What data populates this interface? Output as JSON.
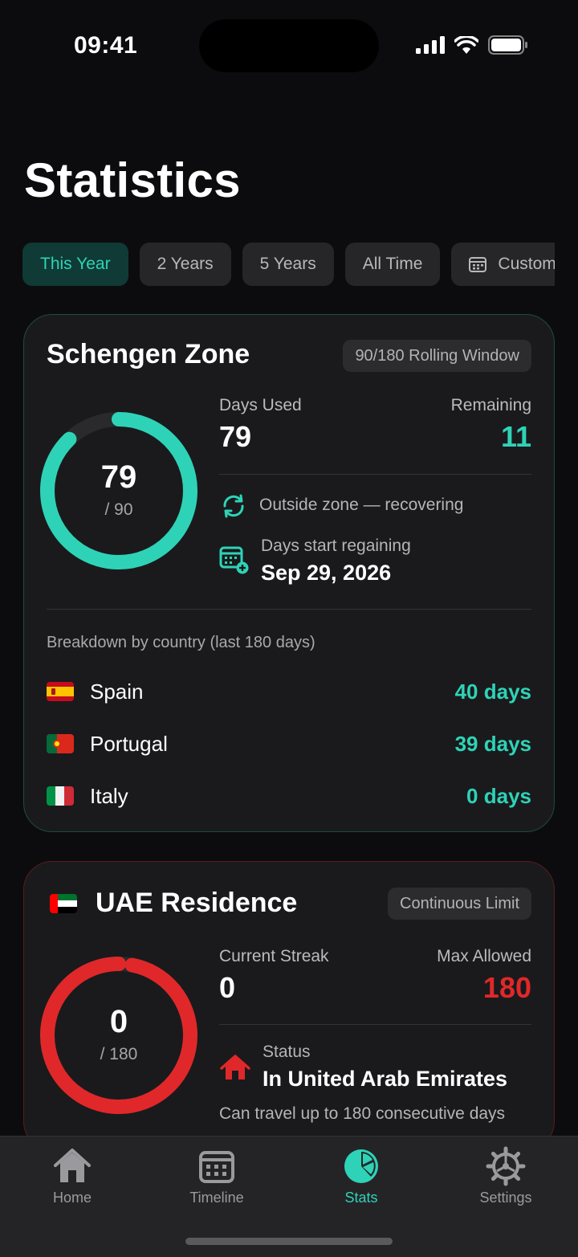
{
  "status_bar": {
    "time": "09:41"
  },
  "page": {
    "title": "Statistics"
  },
  "filters": [
    {
      "label": "This Year",
      "active": true
    },
    {
      "label": "2 Years",
      "active": false
    },
    {
      "label": "5 Years",
      "active": false
    },
    {
      "label": "All Time",
      "active": false
    },
    {
      "label": "Custom",
      "active": false,
      "icon": "calendar-icon"
    }
  ],
  "schengen": {
    "title": "Schengen Zone",
    "badge": "90/180 Rolling Window",
    "ring": {
      "value": "79",
      "sub": "/ 90",
      "progress": 0.878,
      "color": "#2ed3b7"
    },
    "days_used_label": "Days Used",
    "days_used": "79",
    "remaining_label": "Remaining",
    "remaining": "11",
    "status_text": "Outside zone — recovering",
    "regain_label": "Days start regaining",
    "regain_date": "Sep 29, 2026",
    "breakdown_label": "Breakdown by country (last 180 days)",
    "countries": [
      {
        "name": "Spain",
        "days": "40 days",
        "flag": "spain-flag"
      },
      {
        "name": "Portugal",
        "days": "39 days",
        "flag": "portugal-flag"
      },
      {
        "name": "Italy",
        "days": "0 days",
        "flag": "italy-flag"
      }
    ]
  },
  "uae": {
    "title": "UAE Residence",
    "badge": "Continuous Limit",
    "ring": {
      "value": "0",
      "sub": "/ 180",
      "progress": 1.0,
      "color": "#e0282a"
    },
    "streak_label": "Current Streak",
    "streak": "0",
    "max_label": "Max Allowed",
    "max": "180",
    "status_label": "Status",
    "status": "In United Arab Emirates",
    "note": "Can travel up to 180 consecutive days"
  },
  "tabs": [
    {
      "label": "Home",
      "icon": "home-icon",
      "active": false
    },
    {
      "label": "Timeline",
      "icon": "calendar-icon",
      "active": false
    },
    {
      "label": "Stats",
      "icon": "pie-chart-icon",
      "active": true
    },
    {
      "label": "Settings",
      "icon": "gear-icon",
      "active": false
    }
  ]
}
